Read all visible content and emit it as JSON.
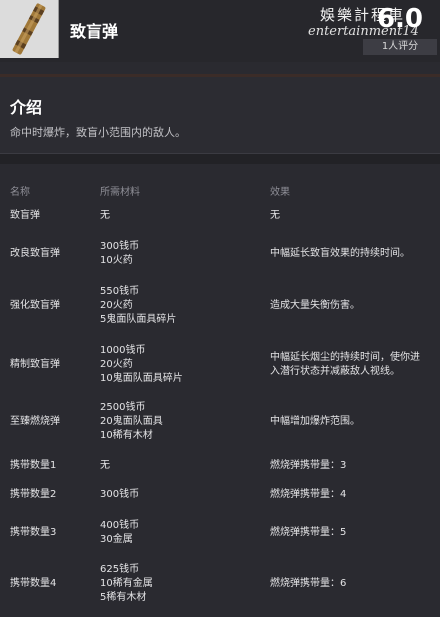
{
  "header": {
    "title": "致盲弹",
    "watermark_cn": "娛樂計程車",
    "watermark_en": "entertainment14",
    "score_value": "6.0",
    "score_label": "1人评分"
  },
  "intro": {
    "title": "介绍",
    "description": "命中时爆炸，致盲小范围内的敌人。"
  },
  "table": {
    "headers": [
      "名称",
      "所需材料",
      "效果"
    ],
    "rows": [
      {
        "name": "致盲弹",
        "materials": [
          "无"
        ],
        "effect": [
          "无"
        ]
      },
      {
        "name": "改良致盲弹",
        "materials": [
          "300钱币",
          "10火药"
        ],
        "effect": [
          "中幅延长致盲效果的持续时间。"
        ]
      },
      {
        "name": "强化致盲弹",
        "materials": [
          "550钱币",
          "20火药",
          "5鬼面队面具碎片"
        ],
        "effect": [
          "造成大量失衡伤害。"
        ]
      },
      {
        "name": "精制致盲弹",
        "materials": [
          "1000钱币",
          "20火药",
          "10鬼面队面具碎片"
        ],
        "effect": [
          "中幅延长烟尘的持续时间，使你进",
          "入潜行状态并减蔽敌人视线。"
        ]
      },
      {
        "name": "至臻燃烧弹",
        "materials": [
          "2500钱币",
          "20鬼面队面具",
          "10稀有木材"
        ],
        "effect": [
          "中幅增加爆炸范围。"
        ]
      },
      {
        "name": "携带数量1",
        "materials": [
          "无"
        ],
        "effect": [
          "燃烧弹携带量：3"
        ]
      },
      {
        "name": "携带数量2",
        "materials": [
          "300钱币"
        ],
        "effect": [
          "燃烧弹携带量：4"
        ]
      },
      {
        "name": "携带数量3",
        "materials": [
          "400钱币",
          "30金属"
        ],
        "effect": [
          "燃烧弹携带量：5"
        ]
      },
      {
        "name": "携带数量4",
        "materials": [
          "625钱币",
          "10稀有金属",
          "5稀有木材"
        ],
        "effect": [
          "燃烧弹携带量：6"
        ]
      }
    ]
  }
}
